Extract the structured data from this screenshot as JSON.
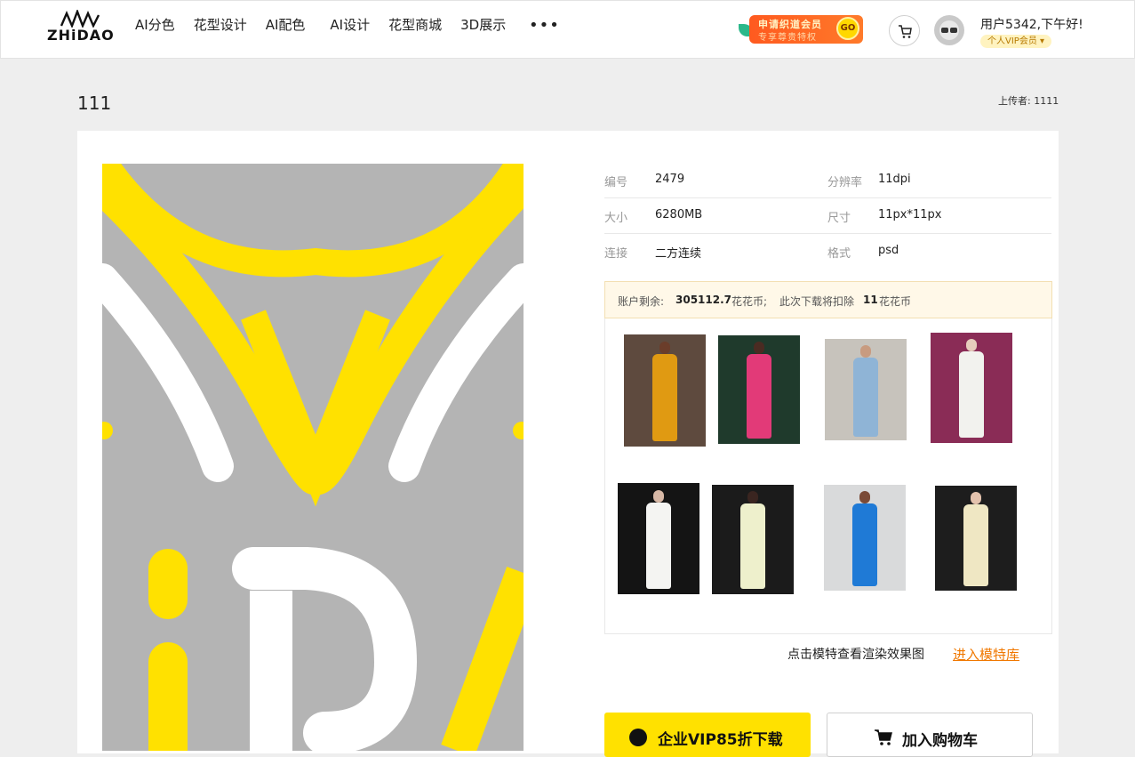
{
  "header": {
    "logo_text": "ZHiDAO",
    "nav": [
      "AI分色",
      "花型设计",
      "AI配色",
      "AI设计",
      "花型商城",
      "3D展示"
    ],
    "more": "•••",
    "promo": {
      "title": "申请织道会员",
      "subtitle": "专享尊贵特权",
      "go": "GO"
    },
    "greeting": "用户5342,下午好!",
    "vip": "个人VIP会员 ▾"
  },
  "page": {
    "title": "111",
    "uploader": "上传者: 1111"
  },
  "info": [
    {
      "l1": "编号",
      "v1": "2479",
      "l2": "分辨率",
      "v2": "11dpi"
    },
    {
      "l1": "大小",
      "v1": "6280MB",
      "l2": "尺寸",
      "v2": "11px*11px"
    },
    {
      "l1": "连接",
      "v1": "二方连续",
      "l2": "格式",
      "v2": "psd"
    }
  ],
  "account": {
    "prefix": "账户剩余:",
    "balance": "305112.7",
    "unit1": "花花币;",
    "deduct_prefix": "此次下载将扣除",
    "deduct": "11",
    "unit2": "花花币"
  },
  "models_hint": "点击模特查看渲染效果图",
  "models_link": "进入模特库",
  "buttons": {
    "download": "企业VIP85折下载",
    "cart": "加入购物车"
  },
  "colors": {
    "accent_yellow": "#ffe100",
    "link_orange": "#f07800",
    "promo_orange": "#ff5a1f"
  }
}
